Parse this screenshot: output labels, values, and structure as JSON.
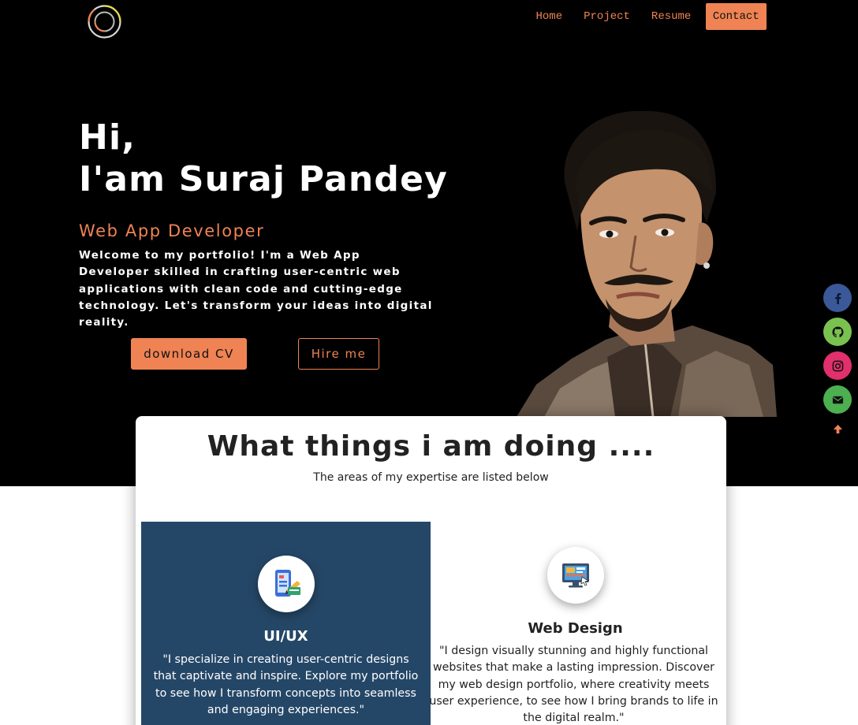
{
  "header": {
    "nav": [
      {
        "label": "Home"
      },
      {
        "label": "Project"
      },
      {
        "label": "Resume"
      },
      {
        "label": "Contact"
      }
    ]
  },
  "hero": {
    "title": "Hi,\nI'am Suraj Pandey",
    "role": "Web App Developer",
    "description": "Welcome to my portfolio! I'm a Web App Developer skilled in crafting user-centric web applications with clean code and cutting-edge technology. Let's transform your ideas into digital reality.",
    "download_label": "download CV",
    "hire_label": "Hire me"
  },
  "social": {
    "icons": [
      "facebook-icon",
      "github-icon",
      "instagram-icon",
      "email-icon",
      "arrow-up-icon"
    ],
    "colors": {
      "facebook": "#3b5998",
      "github": "#7ac24f",
      "instagram": "#e1306c",
      "email": "#4caf50"
    }
  },
  "services": {
    "title": "What things i am doing ....",
    "subtitle": "The areas of my expertise are listed below",
    "items": [
      {
        "name": "UI/UX",
        "text": "\"I specialize in creating user-centric designs that captivate and inspire. Explore my portfolio to see how I transform concepts into seamless and engaging experiences.\""
      },
      {
        "name": "Web Design",
        "text": "\"I design visually stunning and highly functional websites that make a lasting impression. Discover my web design portfolio, where creativity meets user experience, to see how I bring brands to life in the digital realm.\""
      }
    ]
  },
  "theme": {
    "accent": "#ef8354",
    "hero_bg": "#000000",
    "card_blue": "#254767"
  }
}
